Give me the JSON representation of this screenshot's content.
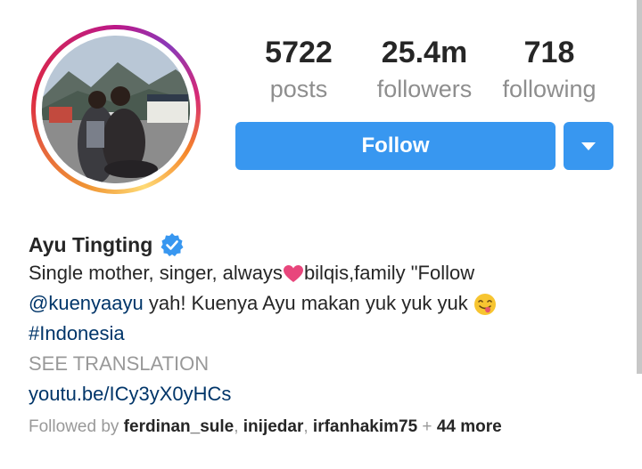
{
  "stats": {
    "posts": {
      "value": "5722",
      "label": "posts"
    },
    "followers": {
      "value": "25.4m",
      "label": "followers"
    },
    "following": {
      "value": "718",
      "label": "following"
    }
  },
  "actions": {
    "follow_label": "Follow",
    "dropdown_icon": "chevron-down-icon"
  },
  "profile": {
    "name": "Ayu Tingting",
    "verified_icon": "verified-badge-icon",
    "bio": {
      "line1_text": "Single mother, singer, always",
      "line1_emoji": "heart-emoji",
      "line1_rest": "bilqis,family \"Follow",
      "line2_mention": "@kuenyaayu",
      "line2_text": " yah! Kuenya Ayu makan yuk yuk yuk",
      "line2_emoji": "yum-face-emoji",
      "hashtag": "#Indonesia",
      "see_translation": "SEE TRANSLATION",
      "link": "youtu.be/ICy3yX0yHCs"
    },
    "followed_by": {
      "prefix": "Followed by ",
      "users": [
        "ferdinan_sule",
        "inijedar",
        "irfanhakim75"
      ],
      "sep": ", ",
      "plus": " + ",
      "more": "44 more"
    }
  },
  "colors": {
    "accent": "#3897f0",
    "link": "#003569",
    "muted": "#999999",
    "heart": "#e8467c"
  }
}
